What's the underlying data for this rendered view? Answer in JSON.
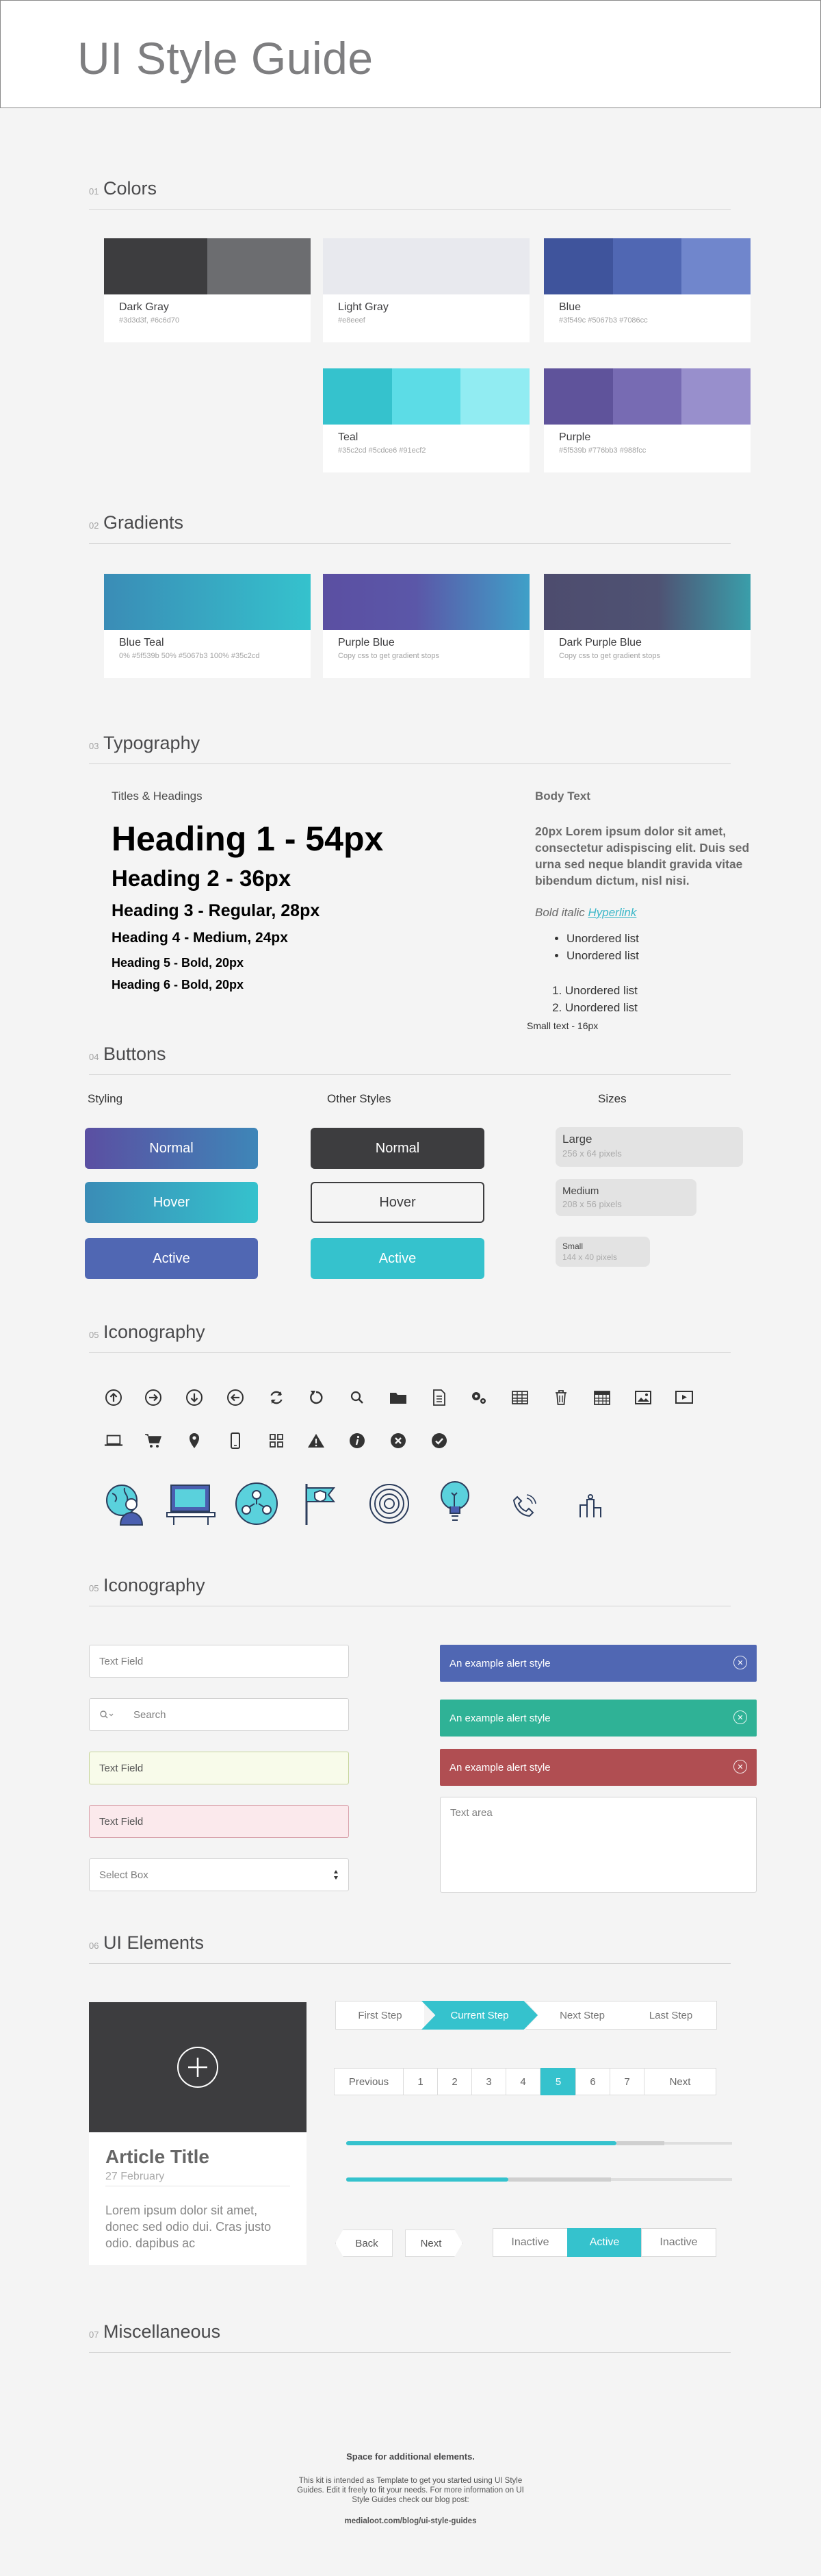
{
  "header": {
    "title": "UI Style Guide"
  },
  "sections": [
    {
      "num": "01",
      "title": "Colors"
    },
    {
      "num": "02",
      "title": "Gradients"
    },
    {
      "num": "03",
      "title": "Typography"
    },
    {
      "num": "04",
      "title": "Buttons"
    },
    {
      "num": "05",
      "title": "Iconography"
    },
    {
      "num": "05",
      "title": "Iconography"
    },
    {
      "num": "06",
      "title": "UI Elements"
    },
    {
      "num": "07",
      "title": "Miscellaneous"
    }
  ],
  "colors": [
    {
      "name": "Dark Gray",
      "codes": "#3d3d3f, #6c6d70",
      "swatches": [
        "#3d3d3f",
        "#6c6d70"
      ]
    },
    {
      "name": "Light Gray",
      "codes": "#e8eeef",
      "swatches": [
        "#e8e9ee"
      ]
    },
    {
      "name": "Blue",
      "codes": "#3f549c #5067b3 #7086cc",
      "swatches": [
        "#3f549c",
        "#5067b3",
        "#7086cc"
      ]
    },
    {
      "name": "Teal",
      "codes": "#35c2cd #5cdce6 #91ecf2",
      "swatches": [
        "#35c2cd",
        "#5cdce6",
        "#91ecf2"
      ]
    },
    {
      "name": "Purple",
      "codes": "#5f539b #776bb3 #988fcc",
      "swatches": [
        "#5f539b",
        "#776bb3",
        "#988fcc"
      ]
    }
  ],
  "gradients": [
    {
      "name": "Blue Teal",
      "codes": "0% #5f539b 50% #5067b3 100% #35c2cd"
    },
    {
      "name": "Purple Blue",
      "codes": "Copy css to get gradient stops"
    },
    {
      "name": "Dark Purple Blue",
      "codes": "Copy css to get gradient stops"
    }
  ],
  "typography": {
    "titles_label": "Titles & Headings",
    "h1": "Heading 1 - 54px",
    "h2": "Heading 2 - 36px",
    "h3": "Heading 3 - Regular, 28px",
    "h4": "Heading 4 - Medium, 24px",
    "h5": "Heading 5 - Bold, 20px",
    "h6": "Heading 6 - Bold, 20px",
    "body_label": "Body Text",
    "body": "20px Lorem ipsum dolor sit amet, consectetur adispiscing elit. Duis sed urna sed neque blandit gravida vitae bibendum dictum, nisl nisi.",
    "bold_italic": "Bold italic",
    "hyperlink": "Hyperlink",
    "ul": [
      "Unordered list",
      "Unordered list"
    ],
    "ol": [
      "Unordered list",
      "Unordered list"
    ],
    "small": "Small text - 16px"
  },
  "buttons": {
    "styling_label": "Styling",
    "other_label": "Other Styles",
    "sizes_label": "Sizes",
    "normal": "Normal",
    "hover": "Hover",
    "active": "Active",
    "large": "Large",
    "large_dim": "256 x 64 pixels",
    "medium": "Medium",
    "medium_dim": "208 x 56 pixels",
    "small": "Small",
    "small_dim": "144 x 40 pixels"
  },
  "forms": {
    "text_field": "Text Field",
    "search": "Search",
    "text_field_ok": "Text Field",
    "text_field_err": "Text Field",
    "select": "Select Box",
    "textarea": "Text area",
    "alerts": [
      "An example alert style",
      "An example alert style",
      "An example alert style"
    ]
  },
  "article": {
    "title": "Article Title",
    "date": "27 February",
    "body": "Lorem ipsum dolor sit amet, donec sed odio dui. Cras justo odio. dapibus ac"
  },
  "steps": [
    "First Step",
    "Current Step",
    "Next Step",
    "Last Step"
  ],
  "pagination": [
    "Previous",
    "1",
    "2",
    "3",
    "4",
    "5",
    "6",
    "7",
    "Next"
  ],
  "sliders": [
    {
      "value": 0.7
    },
    {
      "value": 0.42
    }
  ],
  "nav": {
    "back": "Back",
    "next": "Next"
  },
  "toggle": [
    "Inactive",
    "Active",
    "Inactive"
  ],
  "footer": {
    "title": "Space for additional elements.",
    "text": "This kit is intended as Template to get you started using UI Style Guides. Edit it freely to fit your needs. For more information on UI Style Guides check our blog post:",
    "link": "medialoot.com/blog/ui-style-guides"
  },
  "icons": [
    "arrow-up-icon",
    "arrow-right-icon",
    "arrow-down-icon",
    "arrow-left-icon",
    "refresh-icon",
    "undo-icon",
    "search-icon",
    "folder-icon",
    "document-icon",
    "settings-icon",
    "table-icon",
    "trash-icon",
    "calendar-icon",
    "image-icon",
    "video-icon",
    "laptop-icon",
    "cart-icon",
    "location-icon",
    "mobile-icon",
    "grid-icon",
    "warning-icon",
    "info-icon",
    "close-circle-icon",
    "check-circle-icon"
  ]
}
